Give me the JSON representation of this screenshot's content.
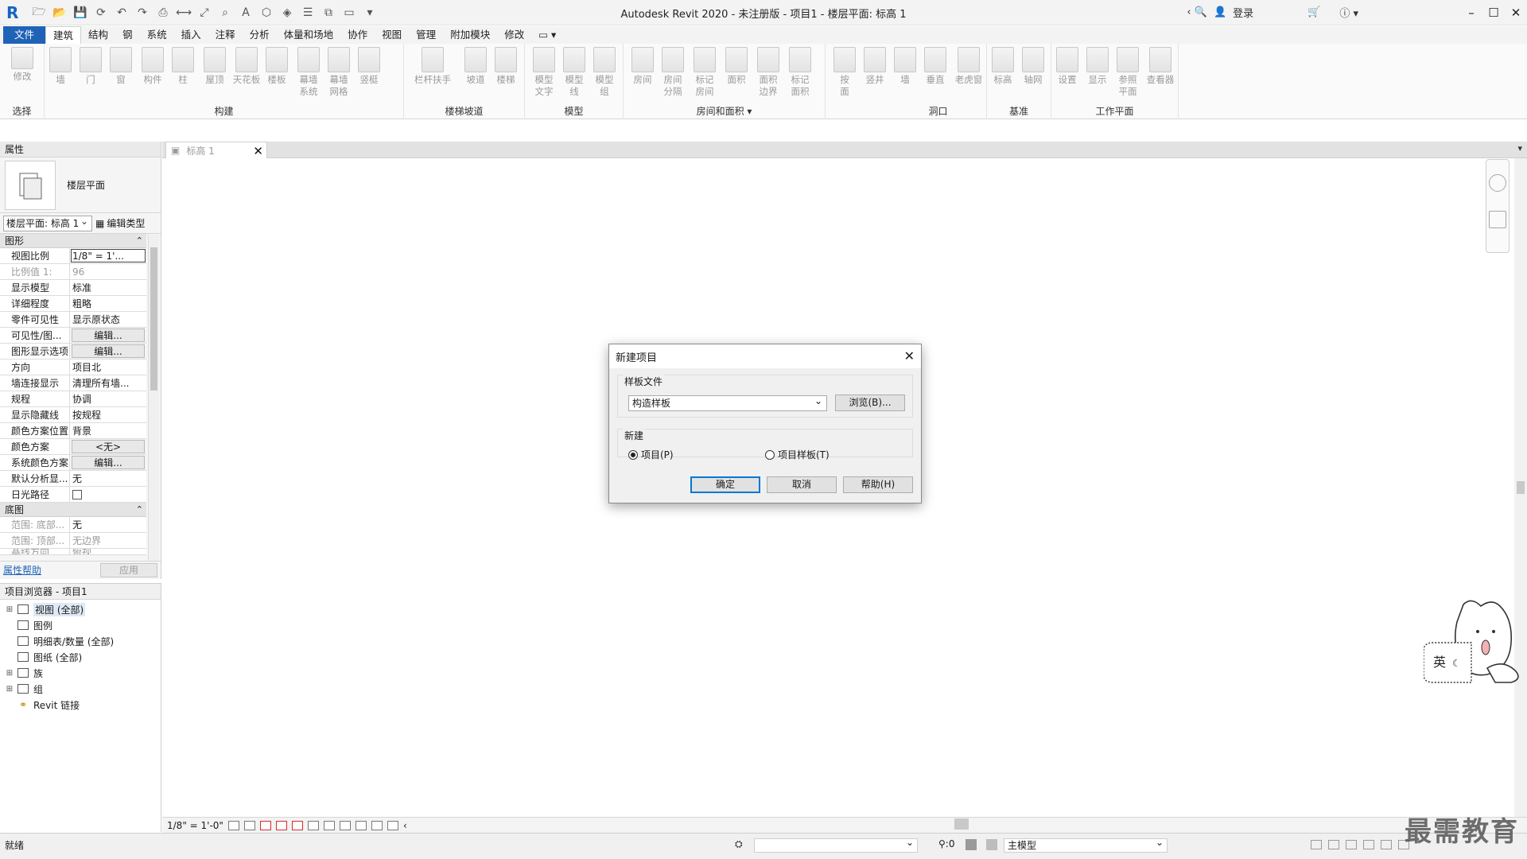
{
  "app": {
    "title": "Autodesk Revit 2020 - 未注册版 - 项目1 - 楼层平面: 标高 1",
    "login": "登录",
    "logo": "R"
  },
  "ribbon": {
    "tabs": [
      {
        "label": "文件"
      },
      {
        "label": "建筑"
      },
      {
        "label": "结构"
      },
      {
        "label": "钢"
      },
      {
        "label": "系统"
      },
      {
        "label": "插入"
      },
      {
        "label": "注释"
      },
      {
        "label": "分析"
      },
      {
        "label": "体量和场地"
      },
      {
        "label": "协作"
      },
      {
        "label": "视图"
      },
      {
        "label": "管理"
      },
      {
        "label": "附加模块"
      },
      {
        "label": "修改"
      }
    ],
    "groups": {
      "select": "选择",
      "build": "构建",
      "stairs": "楼梯坡道",
      "model": "模型",
      "room": "房间和面积",
      "opening": "洞口",
      "datum": "基准",
      "workplane": "工作平面"
    },
    "buttons": {
      "modify": "修改",
      "wall": "墙",
      "door": "门",
      "window": "窗",
      "component": "构件",
      "column": "柱",
      "roof": "屋顶",
      "ceiling": "天花板",
      "floor": "楼板",
      "curtain_system": "幕墙\n系统",
      "curtain_grid": "幕墙\n网格",
      "mullion": "竖梃",
      "railing": "栏杆扶手",
      "ramp": "坡道",
      "stair": "楼梯",
      "model_text": "模型\n文字",
      "model_line": "模型\n线",
      "model_group": "模型\n组",
      "room": "房间",
      "room_sep": "房间\n分隔",
      "tag_room": "标记\n房间",
      "area": "面积",
      "area_boundary": "面积\n边界",
      "tag_area": "标记\n面积",
      "by_face": "按\n面",
      "shaft": "竖井",
      "wall_open": "墙",
      "vertical": "垂直",
      "dormer": "老虎窗",
      "level": "标高",
      "grid": "轴网",
      "set": "设置",
      "show": "显示",
      "ref_plane": "参照\n平面",
      "viewer": "查看器"
    }
  },
  "properties": {
    "title": "属性",
    "type_name": "楼层平面",
    "type_selector": "楼层平面: 标高 1",
    "edit_type": "编辑类型",
    "cat_graphics": "图形",
    "cat_extents": "底图",
    "rows": [
      {
        "k": "视图比例",
        "v": "1/8\" = 1'..."
      },
      {
        "k": "比例值 1:",
        "v": "96"
      },
      {
        "k": "显示模型",
        "v": "标准"
      },
      {
        "k": "详细程度",
        "v": "粗略"
      },
      {
        "k": "零件可见性",
        "v": "显示原状态"
      },
      {
        "k": "可见性/图...",
        "v": "编辑..."
      },
      {
        "k": "图形显示选项",
        "v": "编辑..."
      },
      {
        "k": "方向",
        "v": "项目北"
      },
      {
        "k": "墙连接显示",
        "v": "清理所有墙..."
      },
      {
        "k": "规程",
        "v": "协调"
      },
      {
        "k": "显示隐藏线",
        "v": "按规程"
      },
      {
        "k": "颜色方案位置",
        "v": "背景"
      },
      {
        "k": "颜色方案",
        "v": "<无>"
      },
      {
        "k": "系统颜色方案",
        "v": "编辑..."
      },
      {
        "k": "默认分析显...",
        "v": "无"
      },
      {
        "k": "日光路径",
        "v": ""
      }
    ],
    "rows2": [
      {
        "k": "范围: 底部...",
        "v": "无"
      },
      {
        "k": "范围: 顶部...",
        "v": "无边界"
      },
      {
        "k": "基线方向",
        "v": "俯视"
      }
    ],
    "help": "属性帮助",
    "apply": "应用"
  },
  "browser": {
    "title": "项目浏览器 - 项目1",
    "items": [
      {
        "label": "视图 (全部)"
      },
      {
        "label": "图例"
      },
      {
        "label": "明细表/数量 (全部)"
      },
      {
        "label": "图纸 (全部)"
      },
      {
        "label": "族"
      },
      {
        "label": "组"
      },
      {
        "label": "Revit 链接"
      }
    ]
  },
  "view": {
    "tab_label": "标高 1",
    "scale": "1/8\" = 1'-0\""
  },
  "dialog": {
    "title": "新建项目",
    "template_legend": "样板文件",
    "template_value": "构造样板",
    "browse": "浏览(B)...",
    "new_legend": "新建",
    "radio_project": "项目(P)",
    "radio_template": "项目样板(T)",
    "ok": "确定",
    "cancel": "取消",
    "help": "帮助(H)"
  },
  "status": {
    "text": "就绪",
    "zero": ":0",
    "model": "主模型"
  },
  "mascot": {
    "label": "英"
  },
  "watermark": "最需教育"
}
